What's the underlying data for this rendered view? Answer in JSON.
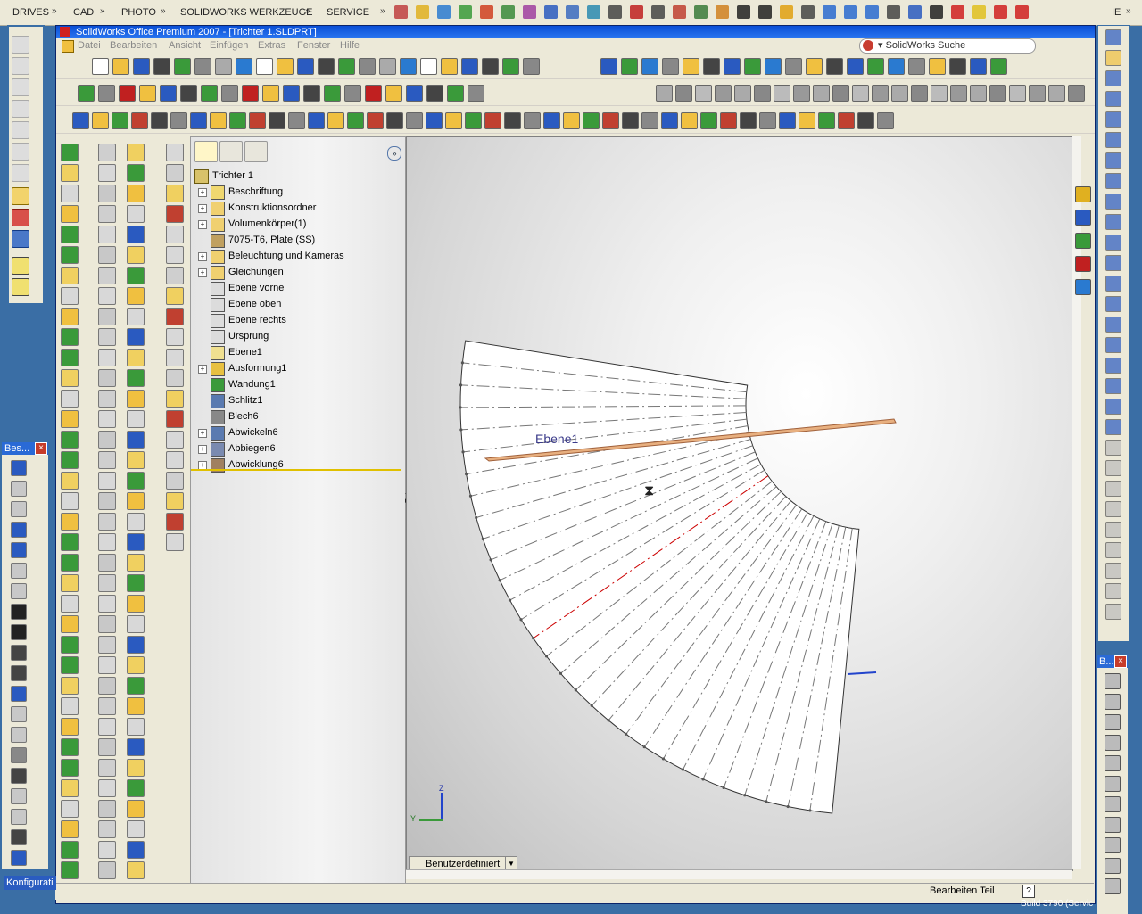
{
  "quick_launch": {
    "items": [
      "DRIVES",
      "CAD",
      "PHOTO",
      "SOLIDWORKS WERKZEUGE",
      "SERVICE"
    ],
    "right_label": "IE"
  },
  "window": {
    "title": "SolidWorks Office Premium 2007 - [Trichter 1.SLDPRT]",
    "search_label": "SolidWorks Suche"
  },
  "menu": [
    "Datei",
    "Bearbeiten",
    "Ansicht",
    "Einfügen",
    "Extras",
    "Fenster",
    "Hilfe"
  ],
  "feature_tree": {
    "root": "Trichter 1",
    "items": [
      {
        "label": "Beschriftung",
        "expandable": true,
        "icon": "annotation-icon"
      },
      {
        "label": "Konstruktionsordner",
        "expandable": true,
        "icon": "design-folder-icon"
      },
      {
        "label": "Volumenkörper(1)",
        "expandable": true,
        "icon": "solid-body-folder-icon"
      },
      {
        "label": "7075-T6, Plate (SS)",
        "expandable": false,
        "icon": "material-icon"
      },
      {
        "label": "Beleuchtung und Kameras",
        "expandable": true,
        "icon": "lighting-icon"
      },
      {
        "label": "Gleichungen",
        "expandable": true,
        "icon": "equations-icon"
      },
      {
        "label": "Ebene vorne",
        "expandable": false,
        "icon": "plane-icon"
      },
      {
        "label": "Ebene oben",
        "expandable": false,
        "icon": "plane-icon"
      },
      {
        "label": "Ebene rechts",
        "expandable": false,
        "icon": "plane-icon"
      },
      {
        "label": "Ursprung",
        "expandable": false,
        "icon": "origin-icon"
      },
      {
        "label": "Ebene1",
        "expandable": false,
        "icon": "plane-icon"
      },
      {
        "label": "Ausformung1",
        "expandable": true,
        "icon": "loft-icon"
      },
      {
        "label": "Wandung1",
        "expandable": false,
        "icon": "shell-icon"
      },
      {
        "label": "Schlitz1",
        "expandable": false,
        "icon": "rip-icon"
      },
      {
        "label": "Blech6",
        "expandable": false,
        "icon": "sheet-metal-icon"
      },
      {
        "label": "Abwickeln6",
        "expandable": true,
        "icon": "unfold-icon"
      },
      {
        "label": "Abbiegen6",
        "expandable": true,
        "icon": "fold-icon"
      },
      {
        "label": "Abwicklung6",
        "expandable": true,
        "icon": "flat-pattern-icon"
      }
    ]
  },
  "graphics": {
    "plane_label": "Ebene1",
    "view_mode": "Benutzerdefiniert",
    "triad_z": "Z",
    "triad_y": "Y"
  },
  "status": {
    "mode": "Bearbeiten Teil",
    "help": "?",
    "build": "Build 3790 (Servic"
  },
  "taskbar": {
    "left_label": "Konfigurati"
  },
  "floating_toolbars": {
    "bes_title": "Bes...",
    "right_title": "B..."
  },
  "colors": {
    "title_blue": "#0a4fd6",
    "desktop": "#3a6ea5",
    "selection_yellow": "#f0d000",
    "plane_orange": "#c8783a",
    "bend_red": "#cc0000"
  }
}
